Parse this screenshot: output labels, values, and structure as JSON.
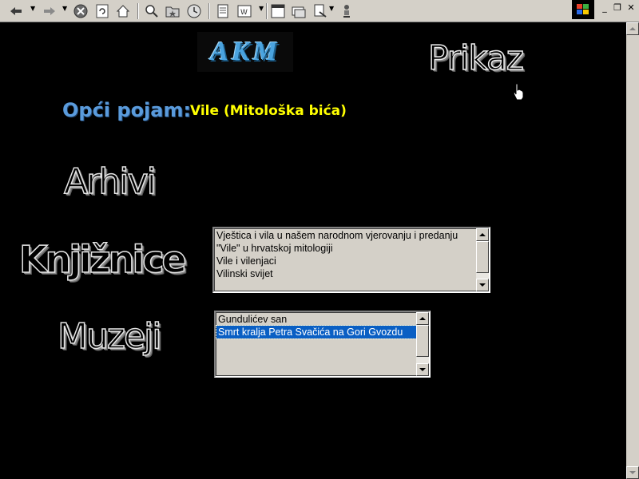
{
  "toolbar": {
    "buttons": [
      "back-icon",
      "forward-icon",
      "stop-icon",
      "refresh-icon",
      "home-icon",
      "search-icon",
      "favorites-icon",
      "history-icon",
      "fullscreen-icon",
      "channels-icon",
      "mail-icon",
      "print-icon",
      "edit-icon",
      "discuss-icon"
    ]
  },
  "header": {
    "logo_text": "AKM",
    "prikaz_label": "Prikaz"
  },
  "concept": {
    "label": "Opći pojam:",
    "value": "Vile (Mitološka bića)"
  },
  "sections": {
    "arhivi": "Arhivi",
    "knjiznice": "Knjižnice",
    "muzeji": "Muzeji"
  },
  "knjiznice_list": {
    "items": [
      "Vještica i vila u našem narodnom vjerovanju i predanju",
      "\"Vile\" u hrvatskoj mitologiji",
      "Vile i vilenjaci",
      "Vilinski svijet"
    ]
  },
  "muzeji_list": {
    "items": [
      "Gundulićev san",
      "Smrt kralja Petra Svačića na Gori Gvozdu"
    ],
    "selected_index": 1
  },
  "colors": {
    "background": "#000000",
    "concept_label": "#5a9bdc",
    "concept_value": "#ffff00",
    "selection": "#0a5fc4"
  }
}
